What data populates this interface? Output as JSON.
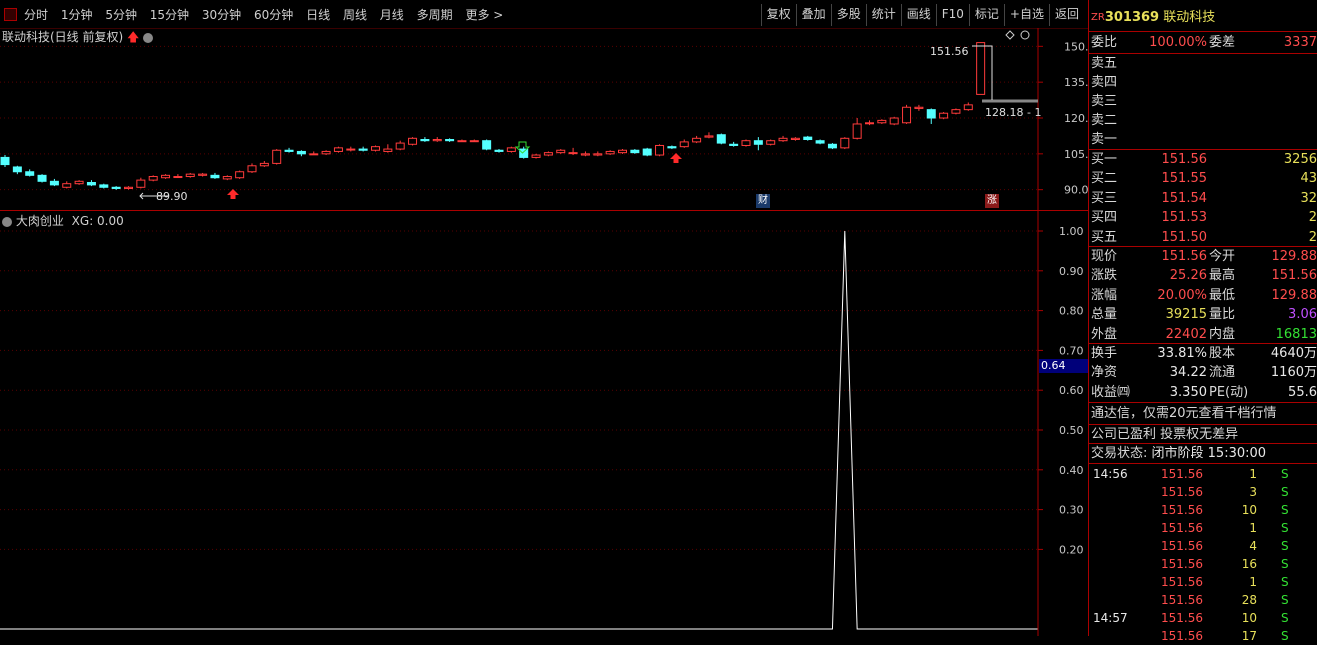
{
  "toolbar": {
    "periods": [
      "分时",
      "1分钟",
      "5分钟",
      "15分钟",
      "30分钟",
      "60分钟",
      "日线",
      "周线",
      "月线",
      "多周期",
      "更多 >"
    ],
    "actions": [
      "复权",
      "叠加",
      "多股",
      "统计",
      "画线",
      "F10",
      "标记",
      "+自选",
      "返回"
    ]
  },
  "kline": {
    "title": "联动科技(日线 前复权)",
    "y_ticks": [
      "150.0",
      "135.0",
      "120.0",
      "105.0",
      "90.00"
    ],
    "high_label": "151.56",
    "low_label": "89.90",
    "price_line_label": "128.18 - 1",
    "badge_cai": "财",
    "badge_zhang": "涨"
  },
  "indicator": {
    "title": "大肉创业",
    "xg_label": "XG: 0.00",
    "y_ticks": [
      "1.00",
      "0.90",
      "0.80",
      "0.70",
      "0.60",
      "0.50",
      "0.40",
      "0.30",
      "0.20"
    ],
    "cursor_value": "0.64"
  },
  "chart_data": {
    "type": "candlestick",
    "title": "联动科技(日线 前复权)",
    "ylim": [
      84,
      156
    ],
    "high": 151.56,
    "low": 89.9,
    "candles": [
      {
        "o": 103.5,
        "c": 100.5,
        "h": 104.5,
        "l": 99.5
      },
      {
        "o": 99.5,
        "c": 97.5,
        "h": 100,
        "l": 96.5
      },
      {
        "o": 97.5,
        "c": 96,
        "h": 98.5,
        "l": 95.5
      },
      {
        "o": 96,
        "c": 93.5,
        "h": 96.5,
        "l": 93
      },
      {
        "o": 93.5,
        "c": 92,
        "h": 94.5,
        "l": 91.5
      },
      {
        "o": 91,
        "c": 92.5,
        "h": 93.5,
        "l": 90.5
      },
      {
        "o": 92.5,
        "c": 93.5,
        "h": 94,
        "l": 92
      },
      {
        "o": 93,
        "c": 92,
        "h": 94,
        "l": 91.5
      },
      {
        "o": 92,
        "c": 91,
        "h": 92.5,
        "l": 90.5
      },
      {
        "o": 91,
        "c": 90.5,
        "h": 91.5,
        "l": 89.9
      },
      {
        "o": 90.5,
        "c": 91,
        "h": 91.5,
        "l": 90
      },
      {
        "o": 91,
        "c": 94,
        "h": 95,
        "l": 90.5
      },
      {
        "o": 94,
        "c": 95.5,
        "h": 96,
        "l": 93.5
      },
      {
        "o": 95,
        "c": 96,
        "h": 96.5,
        "l": 94.5
      },
      {
        "o": 95.5,
        "c": 95.5,
        "h": 96.5,
        "l": 95
      },
      {
        "o": 95.5,
        "c": 96.5,
        "h": 97,
        "l": 95
      },
      {
        "o": 96,
        "c": 96.5,
        "h": 97,
        "l": 95.5
      },
      {
        "o": 96,
        "c": 95,
        "h": 97,
        "l": 94.5
      },
      {
        "o": 94.5,
        "c": 95.5,
        "h": 96,
        "l": 94
      },
      {
        "o": 95,
        "c": 97.5,
        "h": 98,
        "l": 94.5
      },
      {
        "o": 97.5,
        "c": 100,
        "h": 101,
        "l": 97
      },
      {
        "o": 100,
        "c": 101,
        "h": 102,
        "l": 99.5
      },
      {
        "o": 101,
        "c": 106.5,
        "h": 107,
        "l": 100.5
      },
      {
        "o": 106.5,
        "c": 106,
        "h": 107.5,
        "l": 105.5
      },
      {
        "o": 106,
        "c": 105,
        "h": 106.5,
        "l": 104
      },
      {
        "o": 105,
        "c": 105,
        "h": 106,
        "l": 104.5
      },
      {
        "o": 105,
        "c": 106,
        "h": 106.5,
        "l": 104.5
      },
      {
        "o": 106,
        "c": 107.5,
        "h": 108,
        "l": 105.5
      },
      {
        "o": 107,
        "c": 107,
        "h": 108,
        "l": 106
      },
      {
        "o": 107,
        "c": 106.5,
        "h": 108,
        "l": 106
      },
      {
        "o": 106.5,
        "c": 108,
        "h": 108.5,
        "l": 106
      },
      {
        "o": 106,
        "c": 107,
        "h": 109,
        "l": 105.5
      },
      {
        "o": 107,
        "c": 109.5,
        "h": 110.5,
        "l": 106.5
      },
      {
        "o": 109,
        "c": 111.5,
        "h": 112,
        "l": 108.5
      },
      {
        "o": 111,
        "c": 110.5,
        "h": 112,
        "l": 110
      },
      {
        "o": 110.5,
        "c": 111,
        "h": 112,
        "l": 110
      },
      {
        "o": 111,
        "c": 110.5,
        "h": 111.5,
        "l": 110
      },
      {
        "o": 110.5,
        "c": 110.5,
        "h": 111,
        "l": 110
      },
      {
        "o": 110.5,
        "c": 110.5,
        "h": 111,
        "l": 110
      },
      {
        "o": 110.5,
        "c": 107,
        "h": 111,
        "l": 106.5
      },
      {
        "o": 106.5,
        "c": 106,
        "h": 107,
        "l": 105.5
      },
      {
        "o": 106,
        "c": 107.5,
        "h": 108,
        "l": 105.5
      },
      {
        "o": 107,
        "c": 103.5,
        "h": 108,
        "l": 103
      },
      {
        "o": 103.5,
        "c": 104.5,
        "h": 105,
        "l": 103
      },
      {
        "o": 104.5,
        "c": 105.5,
        "h": 106,
        "l": 104
      },
      {
        "o": 105.5,
        "c": 106.5,
        "h": 107,
        "l": 105
      },
      {
        "o": 105.5,
        "c": 105.5,
        "h": 107.5,
        "l": 104.5
      },
      {
        "o": 104.5,
        "c": 105,
        "h": 106,
        "l": 104
      },
      {
        "o": 104.5,
        "c": 105,
        "h": 106,
        "l": 104
      },
      {
        "o": 105,
        "c": 106,
        "h": 106.5,
        "l": 104.5
      },
      {
        "o": 105.5,
        "c": 106.5,
        "h": 107,
        "l": 105
      },
      {
        "o": 106.5,
        "c": 105.5,
        "h": 107,
        "l": 105
      },
      {
        "o": 107,
        "c": 104.5,
        "h": 107.5,
        "l": 104
      },
      {
        "o": 104.5,
        "c": 108.5,
        "h": 109,
        "l": 104
      },
      {
        "o": 108,
        "c": 107.5,
        "h": 108.5,
        "l": 107
      },
      {
        "o": 108,
        "c": 110,
        "h": 111,
        "l": 107.5
      },
      {
        "o": 110,
        "c": 111.5,
        "h": 112.5,
        "l": 109.5
      },
      {
        "o": 112,
        "c": 112.5,
        "h": 114,
        "l": 111.5
      },
      {
        "o": 113,
        "c": 109.5,
        "h": 113.5,
        "l": 109
      },
      {
        "o": 109,
        "c": 108.5,
        "h": 110,
        "l": 108
      },
      {
        "o": 108.5,
        "c": 110.5,
        "h": 111,
        "l": 108
      },
      {
        "o": 110.5,
        "c": 109,
        "h": 112,
        "l": 106.5
      },
      {
        "o": 109,
        "c": 110.5,
        "h": 111,
        "l": 108.5
      },
      {
        "o": 110.5,
        "c": 111.5,
        "h": 112.5,
        "l": 110
      },
      {
        "o": 111,
        "c": 111.5,
        "h": 112,
        "l": 110.5
      },
      {
        "o": 112,
        "c": 111,
        "h": 112.5,
        "l": 110.5
      },
      {
        "o": 110.5,
        "c": 109.5,
        "h": 111,
        "l": 109
      },
      {
        "o": 109,
        "c": 107.5,
        "h": 109.5,
        "l": 107
      },
      {
        "o": 107.5,
        "c": 111.5,
        "h": 112,
        "l": 107
      },
      {
        "o": 111.5,
        "c": 117.5,
        "h": 120,
        "l": 111
      },
      {
        "o": 118,
        "c": 118,
        "h": 119,
        "l": 117
      },
      {
        "o": 118,
        "c": 119,
        "h": 119.5,
        "l": 117.5
      },
      {
        "o": 117.5,
        "c": 120,
        "h": 120.5,
        "l": 117
      },
      {
        "o": 118,
        "c": 124.5,
        "h": 125.5,
        "l": 117.5
      },
      {
        "o": 124,
        "c": 124.5,
        "h": 125.5,
        "l": 123
      },
      {
        "o": 123.5,
        "c": 120,
        "h": 124,
        "l": 117.5
      },
      {
        "o": 120,
        "c": 122,
        "h": 122.5,
        "l": 119.5
      },
      {
        "o": 122,
        "c": 123.5,
        "h": 124,
        "l": 121.5
      },
      {
        "o": 123.5,
        "c": 125.5,
        "h": 126.5,
        "l": 123
      },
      {
        "o": 129.88,
        "c": 151.56,
        "h": 151.56,
        "l": 129.88
      }
    ],
    "indicator_series": {
      "name": "XG",
      "values": [
        0,
        0,
        0,
        0,
        0,
        0,
        0,
        0,
        0,
        0,
        0,
        0,
        0,
        0,
        0,
        0,
        0,
        0,
        0,
        0,
        0,
        0,
        0,
        0,
        0,
        0,
        0,
        0,
        0,
        0,
        0,
        0,
        0,
        0,
        0,
        0,
        0,
        0,
        0,
        0,
        0,
        0,
        0,
        0,
        0,
        0,
        0,
        0,
        0,
        0,
        0,
        0,
        0,
        0,
        0,
        0,
        0,
        0,
        0,
        0,
        0,
        0,
        0,
        0,
        0,
        0,
        0,
        0,
        1,
        0,
        0,
        0,
        0,
        0,
        0,
        0,
        0,
        0,
        0,
        0
      ],
      "ylim": [
        0,
        1
      ]
    }
  },
  "quote": {
    "prefix": "ZR",
    "code": "301369",
    "name": "联动科技",
    "weibi_label": "委比",
    "weibi_value": "100.00%",
    "weicha_label": "委差",
    "weicha_value": "3337",
    "asks": [
      {
        "label": "卖五",
        "price": "",
        "vol": ""
      },
      {
        "label": "卖四",
        "price": "",
        "vol": ""
      },
      {
        "label": "卖三",
        "price": "",
        "vol": ""
      },
      {
        "label": "卖二",
        "price": "",
        "vol": ""
      },
      {
        "label": "卖一",
        "price": "",
        "vol": ""
      }
    ],
    "bids": [
      {
        "label": "买一",
        "price": "151.56",
        "vol": "3256"
      },
      {
        "label": "买二",
        "price": "151.55",
        "vol": "43"
      },
      {
        "label": "买三",
        "price": "151.54",
        "vol": "32"
      },
      {
        "label": "买四",
        "price": "151.53",
        "vol": "2"
      },
      {
        "label": "买五",
        "price": "151.50",
        "vol": "2"
      }
    ],
    "stats": [
      {
        "l1": "现价",
        "v1": "151.56",
        "c1": "red",
        "l2": "今开",
        "v2": "129.88",
        "c2": "red"
      },
      {
        "l1": "涨跌",
        "v1": "25.26",
        "c1": "red",
        "l2": "最高",
        "v2": "151.56",
        "c2": "red"
      },
      {
        "l1": "涨幅",
        "v1": "20.00%",
        "c1": "red",
        "l2": "最低",
        "v2": "129.88",
        "c2": "red"
      },
      {
        "l1": "总量",
        "v1": "39215",
        "c1": "yel",
        "l2": "量比",
        "v2": "3.06",
        "c2": "purple"
      },
      {
        "l1": "外盘",
        "v1": "22402",
        "c1": "red",
        "l2": "内盘",
        "v2": "16813",
        "c2": "green"
      }
    ],
    "stats2": [
      {
        "l1": "换手",
        "v1": "33.81%",
        "l2": "股本",
        "v2": "4640万"
      },
      {
        "l1": "净资",
        "v1": "34.22",
        "l2": "流通",
        "v2": "1160万"
      },
      {
        "l1": "收益㈣",
        "v1": "3.350",
        "l2": "PE(动)",
        "v2": "55.6"
      }
    ],
    "ad_text": "通达信，仅需20元查看千档行情",
    "notice_text": "公司已盈利 投票权无差异",
    "status_label": "交易状态:",
    "status_value": "闭市阶段 15:30:00"
  },
  "ticks": [
    {
      "time": "14:56",
      "price": "151.56",
      "vol": "1",
      "side": "S"
    },
    {
      "time": "",
      "price": "151.56",
      "vol": "3",
      "side": "S"
    },
    {
      "time": "",
      "price": "151.56",
      "vol": "10",
      "side": "S"
    },
    {
      "time": "",
      "price": "151.56",
      "vol": "1",
      "side": "S"
    },
    {
      "time": "",
      "price": "151.56",
      "vol": "4",
      "side": "S"
    },
    {
      "time": "",
      "price": "151.56",
      "vol": "16",
      "side": "S"
    },
    {
      "time": "",
      "price": "151.56",
      "vol": "1",
      "side": "S"
    },
    {
      "time": "",
      "price": "151.56",
      "vol": "28",
      "side": "S"
    },
    {
      "time": "14:57",
      "price": "151.56",
      "vol": "10",
      "side": "S"
    },
    {
      "time": "",
      "price": "151.56",
      "vol": "17",
      "side": "S"
    }
  ],
  "colors": {
    "up": "#ff3b3b",
    "down": "#54ffff",
    "grid": "#8b0000",
    "axis_text": "#c8c8c8",
    "indicator_line": "#ffffff",
    "cursor_box": "#00007a"
  }
}
